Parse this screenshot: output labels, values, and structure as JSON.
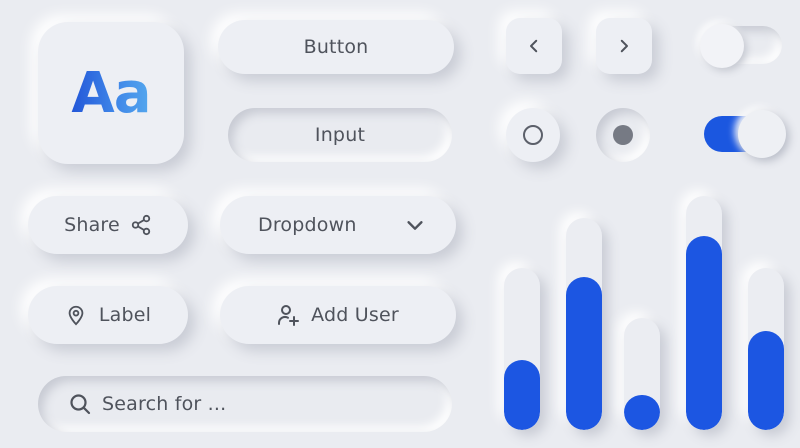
{
  "typography_tile": {
    "text": "Aa"
  },
  "button": {
    "label": "Button"
  },
  "input": {
    "label": "Input"
  },
  "share": {
    "label": "Share",
    "icon": "share-icon"
  },
  "dropdown": {
    "label": "Dropdown",
    "icon": "chevron-down-icon"
  },
  "label_chip": {
    "label": "Label",
    "icon": "map-pin-icon"
  },
  "add_user": {
    "label": "Add User",
    "icon": "user-plus-icon"
  },
  "search": {
    "placeholder": "Search for ...",
    "icon": "search-icon"
  },
  "pager": {
    "prev_icon": "chevron-left-icon",
    "next_icon": "chevron-right-icon"
  },
  "radios": [
    {
      "selected": false
    },
    {
      "selected": true
    }
  ],
  "toggles": [
    {
      "on": false
    },
    {
      "on": true
    }
  ],
  "accent_color": "#1c56e2",
  "sliders": [
    {
      "level": 0.43
    },
    {
      "level": 0.72
    },
    {
      "level": 0.31
    },
    {
      "level": 0.83
    },
    {
      "level": 0.61
    }
  ]
}
